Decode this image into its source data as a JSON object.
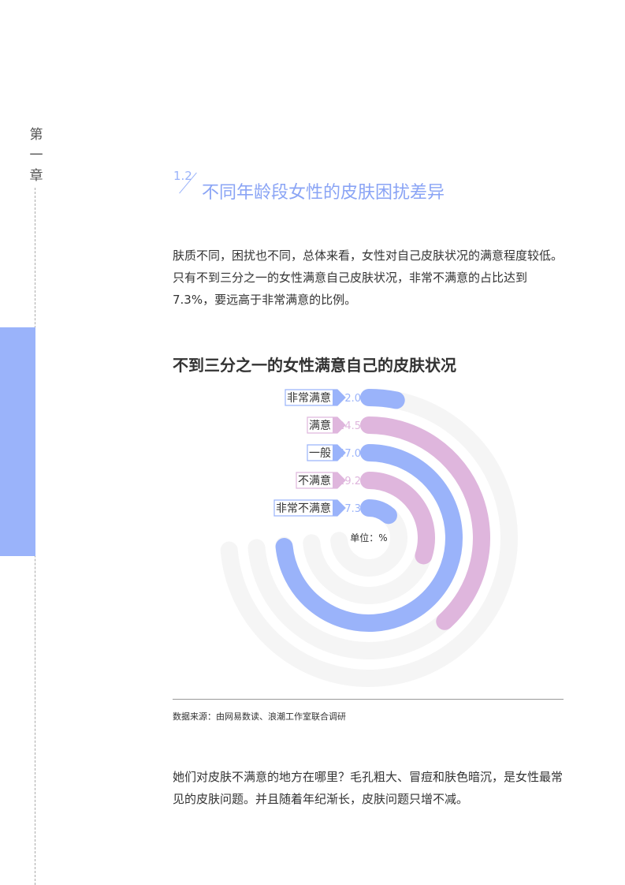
{
  "sidebar": {
    "chapter_chars": [
      "第",
      "一",
      "章"
    ]
  },
  "section": {
    "number": "1.2",
    "title": "不同年龄段女性的皮肤困扰差异"
  },
  "intro": "肤质不同，困扰也不同，总体来看，女性对自己皮肤状况的满意程度较低。只有不到三分之一的女性满意自己皮肤状况，非常不满意的占比达到 7.3%，要远高于非常满意的比例。",
  "chart_data": {
    "type": "radial-bar",
    "title": "不到三分之一的女性满意自己的皮肤状况",
    "unit_label": "单位：%",
    "categories": [
      "非常满意",
      "满意",
      "一般",
      "不满意",
      "非常不满意"
    ],
    "values": [
      2.0,
      24.5,
      47.0,
      19.2,
      7.3
    ],
    "value_labels": [
      "2.0",
      "24.5",
      "47.0",
      "19.2",
      "7.3"
    ],
    "colors": [
      "#9ab3fa",
      "#dfb6dd",
      "#9ab3fa",
      "#dfb6dd",
      "#9ab3fa"
    ],
    "track_color": "#f5f5f5"
  },
  "source": "数据来源：由网易数读、浪潮工作室联合调研",
  "outro": "她们对皮肤不满意的地方在哪里？毛孔粗大、冒痘和肤色暗沉，是女性最常见的皮肤问题。并且随着年纪渐长，皮肤问题只增不减。"
}
